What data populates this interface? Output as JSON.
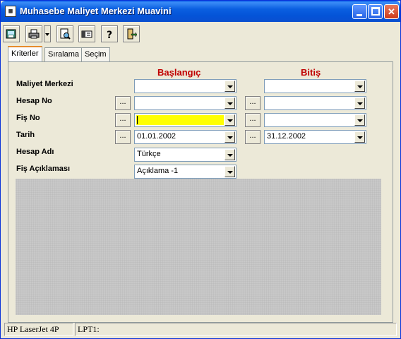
{
  "window": {
    "title": "Muhasebe Maliyet Merkezi Muavini"
  },
  "toolbar": {
    "buttons": [
      "export-icon",
      "printer-icon",
      "preview-icon",
      "card-icon",
      "help-icon",
      "exit-icon"
    ]
  },
  "tabs": [
    {
      "label": "Kriterler"
    },
    {
      "label": "Sıralama"
    },
    {
      "label": "Seçim"
    }
  ],
  "form": {
    "start_header": "Başlangıç",
    "end_header": "Bitiş",
    "rows": {
      "maliyet_merkezi": {
        "label": "Maliyet Merkezi",
        "start": "",
        "end": ""
      },
      "hesap_no": {
        "label": "Hesap No",
        "start": "",
        "end": ""
      },
      "fis_no": {
        "label": "Fiş No",
        "start": "",
        "end": ""
      },
      "tarih": {
        "label": "Tarih",
        "start": "01.01.2002",
        "end": "31.12.2002"
      },
      "hesap_adi": {
        "label": "Hesap Adı",
        "value": "Türkçe"
      },
      "fis_aciklamasi": {
        "label": "Fiş Açıklaması",
        "value": "Açıklama -1"
      }
    },
    "picker_label": "..."
  },
  "status": {
    "printer": "HP LaserJet 4P",
    "port": "LPT1:"
  },
  "colors": {
    "titlebar": "#0a5fe0",
    "header_red": "#c00000",
    "highlight_yellow": "#ffff00"
  }
}
